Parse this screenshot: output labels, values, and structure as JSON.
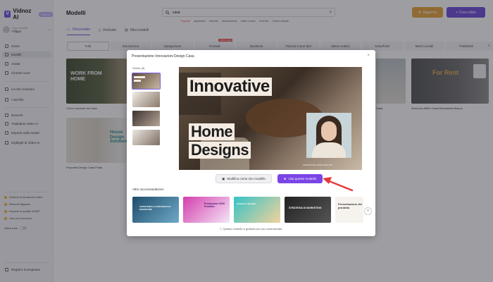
{
  "app": {
    "name": "Vidnoz AI",
    "badge": "Gratuito"
  },
  "user": {
    "plan": "Piano di tariffe",
    "name": "Filippo"
  },
  "sidebar": {
    "items": [
      {
        "label": "Home"
      },
      {
        "label": "Modelli"
      },
      {
        "label": "Avatar"
      },
      {
        "label": "Clonare voce"
      },
      {
        "label": "Le mie creazioni"
      },
      {
        "label": "I miei file"
      },
      {
        "label": "Doscent"
      },
      {
        "label": "Traduttore video AI"
      },
      {
        "label": "Esporta sulla Avatar"
      },
      {
        "label": "Highlight di Video AI"
      }
    ],
    "promo": [
      {
        "label": "Estendi la durata del video"
      },
      {
        "label": "Rimuovi filigrana"
      },
      {
        "label": "Esporta in qualità 1080P"
      },
      {
        "label": "Usa voci premium"
      }
    ],
    "toggle_label": "Attiva tutto",
    "rewards": "Regali e ricompense"
  },
  "header": {
    "title": "Modelli",
    "search_value": "casa",
    "upgrade": "Aggiorna",
    "create": "Crea video"
  },
  "chips": [
    "Popolari",
    "capodanno",
    "Aziende",
    "presentazione",
    "online course",
    "YouTube",
    "Cartoni animati"
  ],
  "subtabs": [
    {
      "label": "Orizzontale"
    },
    {
      "label": "Verticale"
    },
    {
      "label": "Miei modelli"
    }
  ],
  "categories": [
    {
      "label": "Tutti"
    },
    {
      "label": "Educazione"
    },
    {
      "label": "Spiegazione"
    },
    {
      "label": "Festival",
      "badge": "POPOLARE"
    },
    {
      "label": "Business"
    },
    {
      "label": "Tutorial Come fare"
    },
    {
      "label": "Ultime notizie"
    },
    {
      "label": "Salud/Vivir"
    },
    {
      "label": "Mezzi sociali"
    },
    {
      "label": "Pubblicità"
    }
  ],
  "gallery": {
    "work_title": "WORK FROM HOME",
    "work_caption": "Come Lavorare da Casa",
    "house_title": "House Design Solution",
    "house_caption": "Proposta Design Casa Pulita",
    "rent_title": "For Rent",
    "rent_caption": "Annuncio Affitto Casa Minimalista Bianca",
    "mid_caption": "Casa"
  },
  "modal": {
    "title": "Presentazione Innovazioni Design Casa",
    "scenes_label": "Scene (4)",
    "preview_words": [
      "Innovative",
      "Home",
      "Designs"
    ],
    "preview_footer": "INNOVATIVE HOME DESIGNS",
    "edit_button": "Modifica come mio modello",
    "use_button": "Usa questo modello",
    "rec_label": "Altre raccomandazioni",
    "recs": [
      {
        "title": "ASSISTENZA AI STRATEGIA DI MARKETING"
      },
      {
        "title": "Promozione 2025 Prodotto"
      },
      {
        "title": "Vendita al dettaglio"
      },
      {
        "title": "STRATEGIA DI MARKETING"
      },
      {
        "title": "Presentazione del prodotto"
      }
    ],
    "footer": "Questo modello è gratuito per uso commerciale."
  },
  "colors": {
    "accent": "#7b45e6",
    "upgrade": "#e4a134",
    "arrow": "#e23b3b"
  }
}
